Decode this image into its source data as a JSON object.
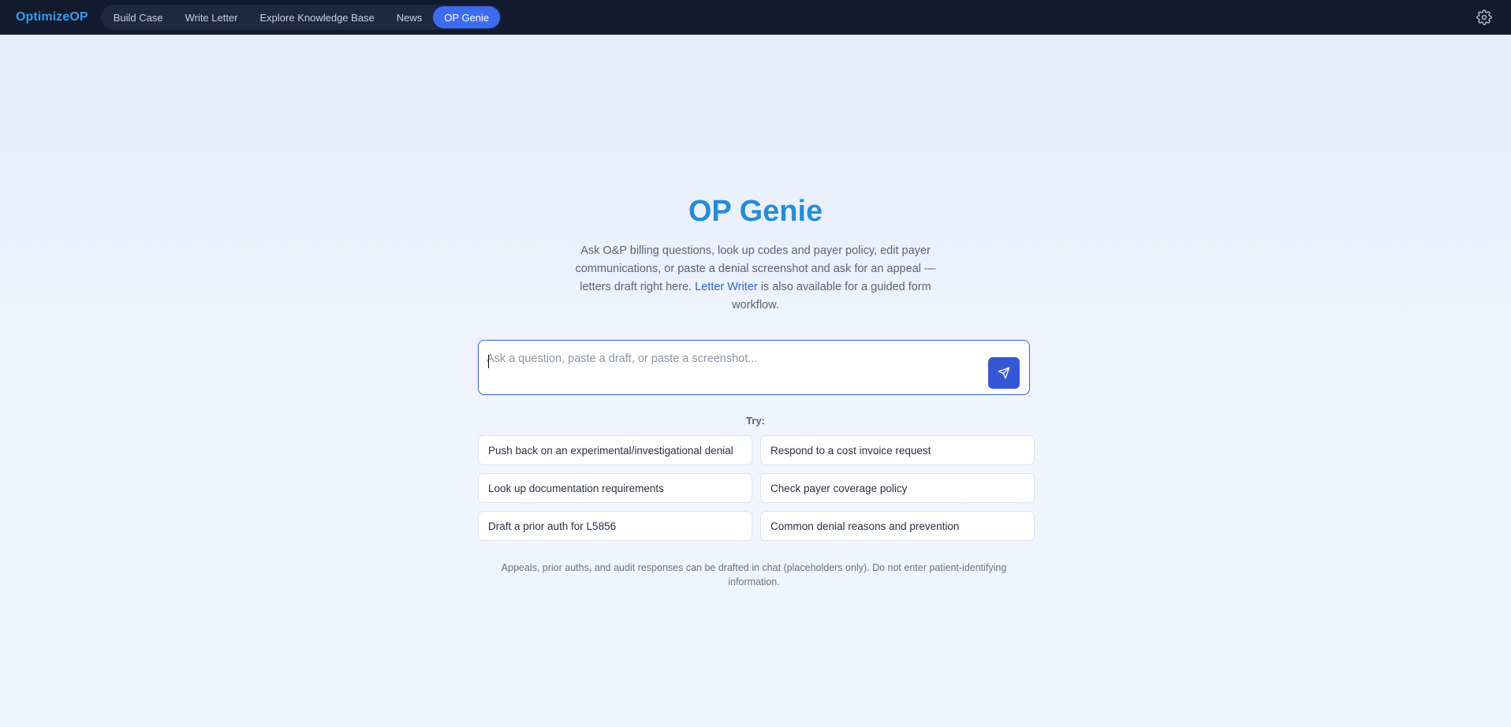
{
  "app": {
    "brand": "OptimizeOP"
  },
  "nav": {
    "items": [
      {
        "label": "Build Case"
      },
      {
        "label": "Write Letter"
      },
      {
        "label": "Explore Knowledge Base"
      },
      {
        "label": "News"
      },
      {
        "label": "OP Genie",
        "active": true
      }
    ],
    "settings_icon": "gear-icon"
  },
  "main": {
    "title": "OP Genie",
    "description_before": "Ask O&P billing questions, look up codes and payer policy, edit payer communications, or paste a denial screenshot and ask for an appeal — letters draft right here. ",
    "description_link": "Letter Writer",
    "description_after": " is also available for a guided form workflow.",
    "input": {
      "value": "",
      "placeholder": "Ask a question, paste a draft, or paste a screenshot..."
    },
    "send_icon": "send-icon",
    "try_label": "Try:",
    "suggestions": [
      "Push back on an experimental/investigational denial",
      "Respond to a cost invoice request",
      "Look up documentation requirements",
      "Check payer coverage policy",
      "Draft a prior auth for L5856",
      "Common denial reasons and prevention"
    ],
    "footer_note": "Appeals, prior auths, and audit responses can be drafted in chat (placeholders only). Do not enter patient-identifying information."
  },
  "colors": {
    "topbar": "#111a2e",
    "brand": "#3b9be8",
    "accent": "#3d6bf0",
    "send_button": "#3557d6",
    "link": "#2f62d8"
  }
}
